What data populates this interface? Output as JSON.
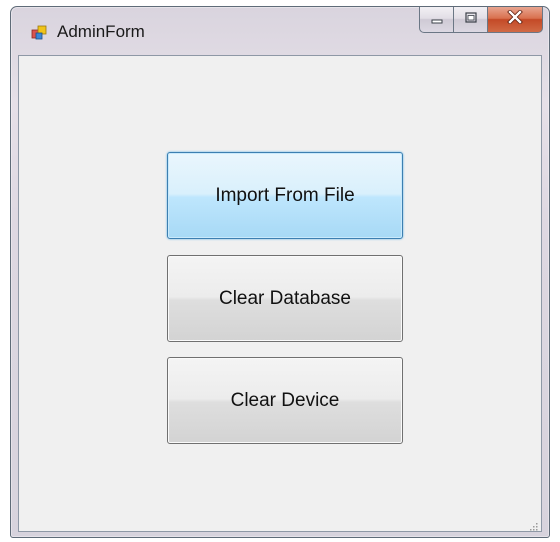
{
  "window": {
    "title": "AdminForm",
    "icons": {
      "app": "app-icon",
      "minimize": "minimize-icon",
      "maximize": "maximize-icon",
      "close": "close-icon",
      "grip": "size-grip-icon"
    }
  },
  "buttons": {
    "import_label": "Import From File",
    "clear_database_label": "Clear Database",
    "clear_device_label": "Clear Device"
  },
  "colors": {
    "close_button": "#c44a27",
    "focus_border": "#3c7fb1",
    "client_background": "#f0f0f0"
  }
}
